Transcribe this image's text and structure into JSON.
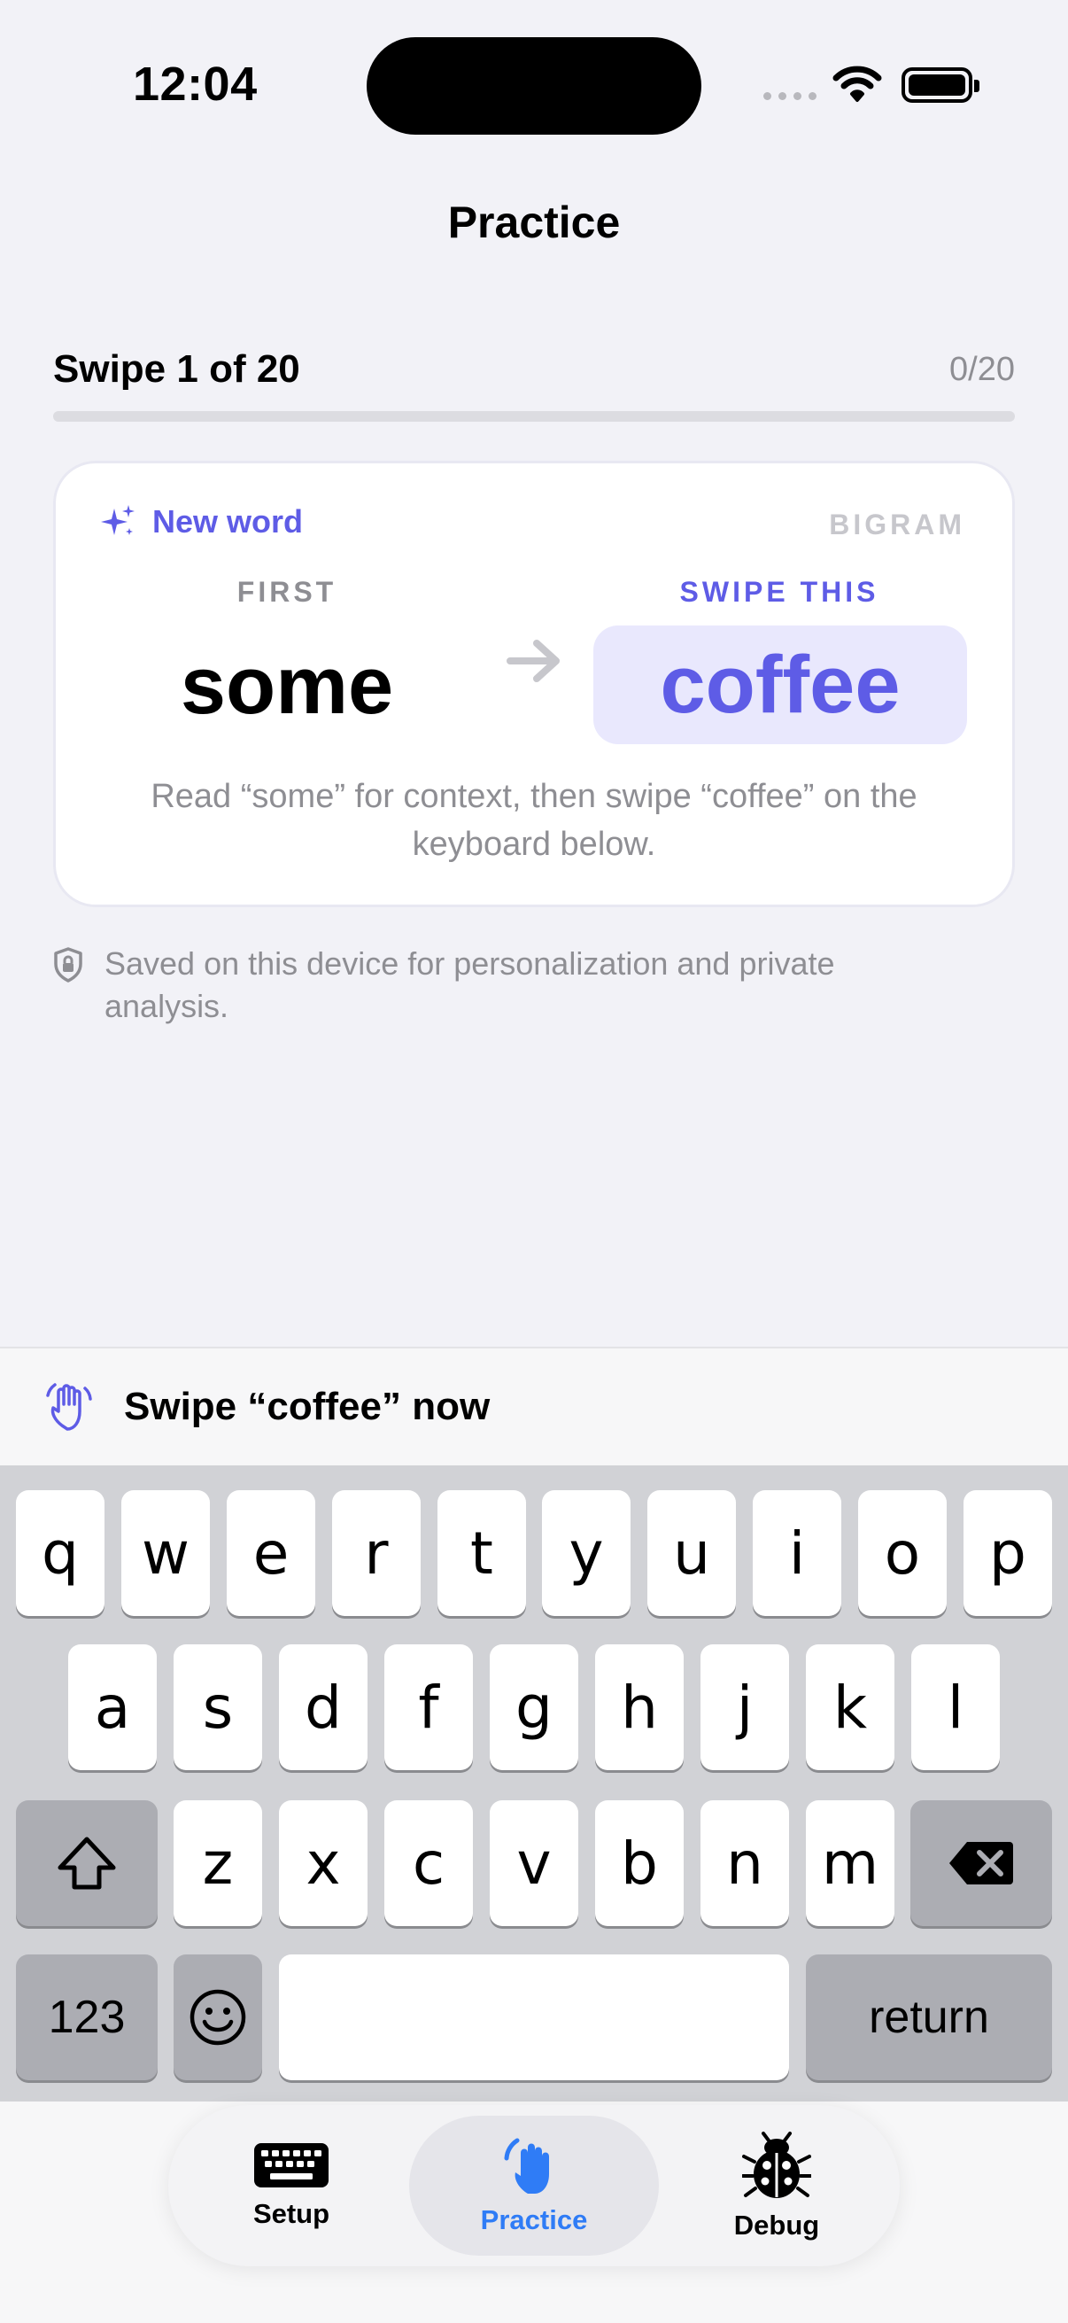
{
  "status_bar": {
    "time": "12:04"
  },
  "nav": {
    "title": "Practice"
  },
  "progress": {
    "label": "Swipe 1 of 20",
    "count": "0/20",
    "fraction": 0
  },
  "card": {
    "badge": "New word",
    "kind": "BIGRAM",
    "first_label": "FIRST",
    "first_word": "some",
    "swipe_label": "SWIPE THIS",
    "target_word": "coffee",
    "instruction": "Read “some” for context, then swipe “coffee” on the keyboard below."
  },
  "privacy_note": "Saved on this device for personalization and private analysis.",
  "prompt": {
    "text": "Swipe “coffee” now"
  },
  "keyboard": {
    "row1": [
      "q",
      "w",
      "e",
      "r",
      "t",
      "y",
      "u",
      "i",
      "o",
      "p"
    ],
    "row2": [
      "a",
      "s",
      "d",
      "f",
      "g",
      "h",
      "j",
      "k",
      "l"
    ],
    "row3": [
      "z",
      "x",
      "c",
      "v",
      "b",
      "n",
      "m"
    ],
    "numbers_label": "123",
    "return_label": "return"
  },
  "tabs": [
    {
      "label": "Setup",
      "icon": "keyboard-icon",
      "active": false
    },
    {
      "label": "Practice",
      "icon": "hand-swipe-icon",
      "active": true
    },
    {
      "label": "Debug",
      "icon": "ladybug-icon",
      "active": false
    }
  ],
  "colors": {
    "accent": "#5e5ce6",
    "tab_active": "#2f7cf6",
    "secondary_text": "#8e8e93"
  }
}
